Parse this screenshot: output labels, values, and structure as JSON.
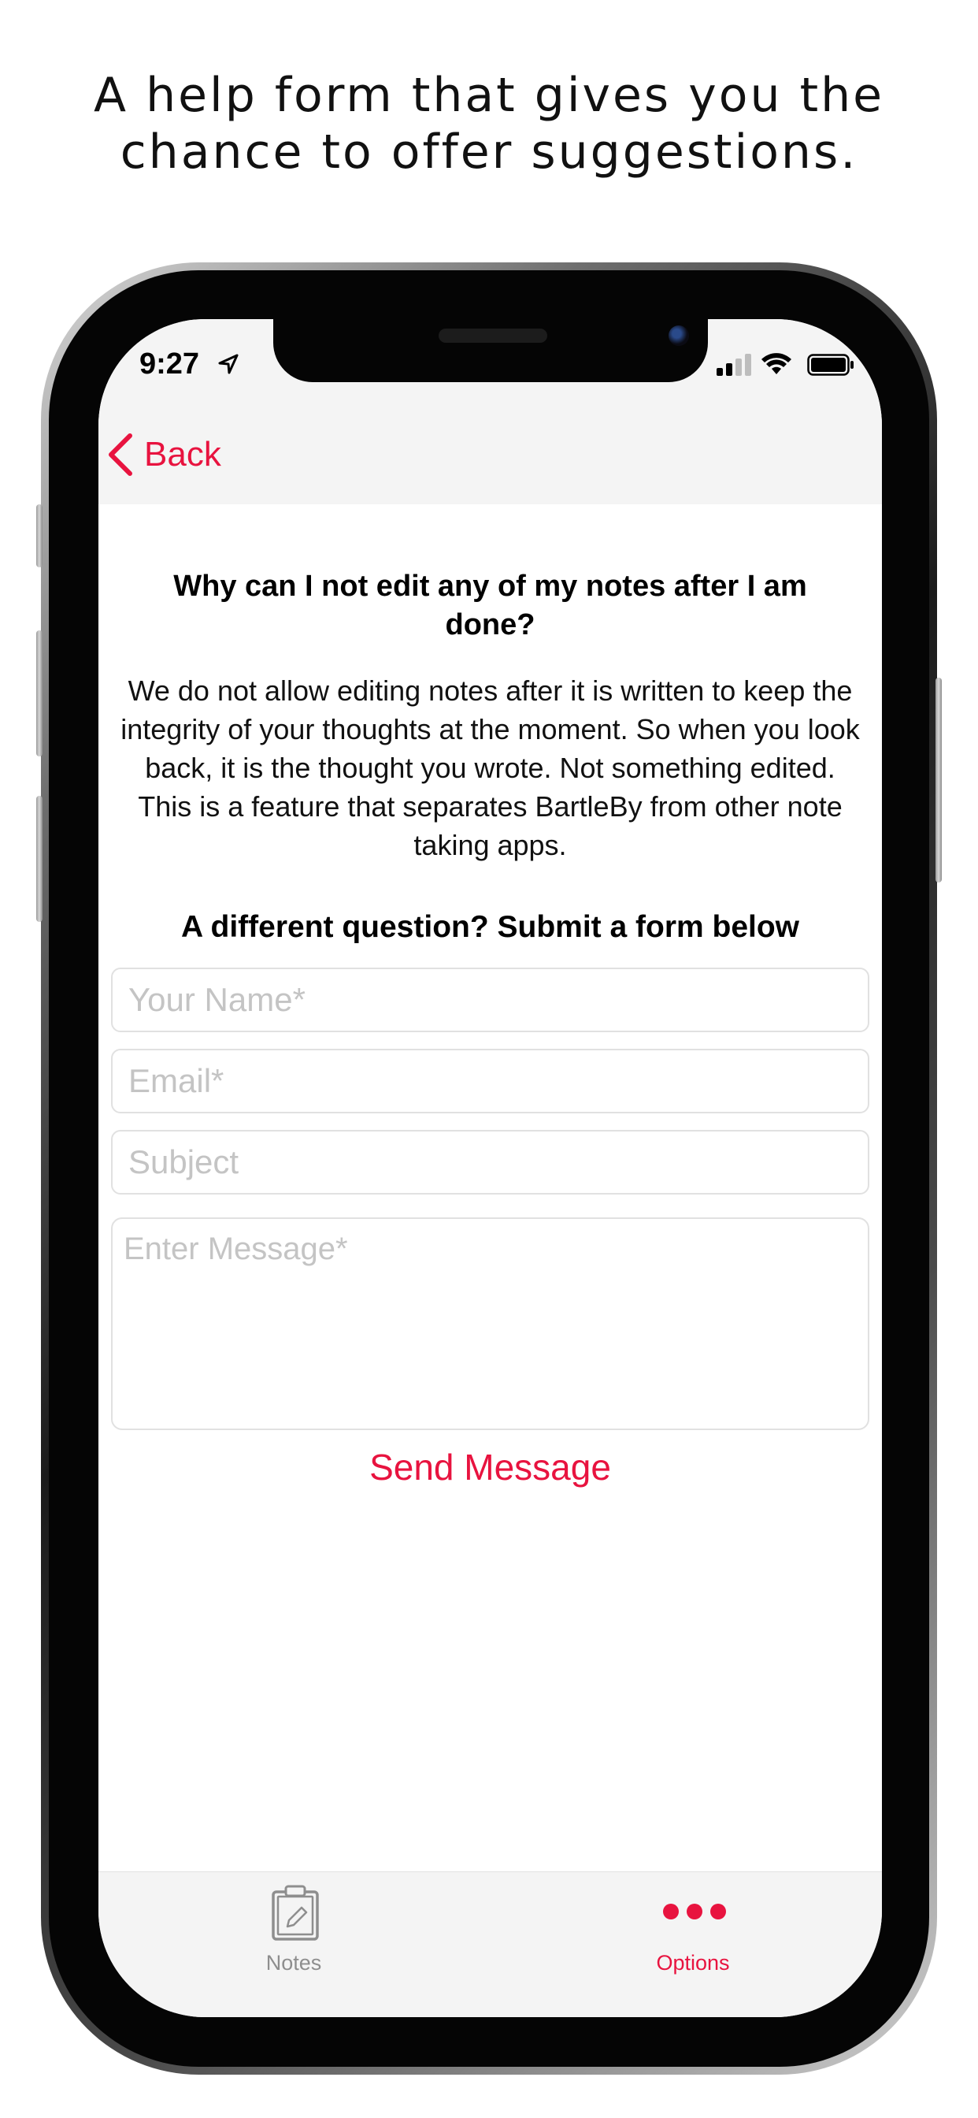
{
  "caption": {
    "line1": "A help form that gives you the",
    "line2": "chance to offer suggestions."
  },
  "status_bar": {
    "time": "9:27"
  },
  "nav": {
    "back_label": "Back"
  },
  "faq": {
    "question": "Why can I not edit any of my notes after I am done?",
    "answer": "We do not allow editing notes after it is written to keep the integrity of your thoughts at the moment. So when you look back, it is the thought you wrote. Not something edited. This is a feature that separates BartleBy from other note taking apps."
  },
  "form": {
    "title": "A different question? Submit a form below",
    "name_placeholder": "Your Name*",
    "email_placeholder": "Email*",
    "subject_placeholder": "Subject",
    "message_placeholder": "Enter Message*",
    "send_label": "Send Message"
  },
  "tab_bar": {
    "tabs": [
      {
        "label": "Notes",
        "icon": "clipboard-pencil-icon",
        "selected": false
      },
      {
        "label": "Options",
        "icon": "three-dots-icon",
        "selected": true
      }
    ]
  },
  "colors": {
    "accent": "#e8133f",
    "bar_background": "#f4f4f4",
    "inactive_tab": "#8e8e8e"
  }
}
